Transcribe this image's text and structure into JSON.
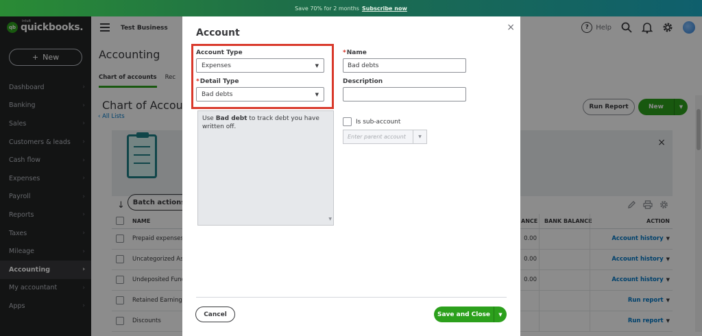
{
  "promo": {
    "text": "Save 70% for 2 months",
    "link": "Subscribe now"
  },
  "sidebar": {
    "brand_small": "intuit",
    "brand": "quickbooks.",
    "logo_mark": "qb",
    "new_plus": "+",
    "new_label": "New",
    "chevron": "›",
    "items": [
      {
        "label": "Dashboard"
      },
      {
        "label": "Banking"
      },
      {
        "label": "Sales"
      },
      {
        "label": "Customers & leads"
      },
      {
        "label": "Cash flow"
      },
      {
        "label": "Expenses"
      },
      {
        "label": "Payroll"
      },
      {
        "label": "Reports"
      },
      {
        "label": "Taxes"
      },
      {
        "label": "Mileage"
      },
      {
        "label": "Accounting"
      },
      {
        "label": "My accountant"
      },
      {
        "label": "Apps"
      }
    ],
    "active_index": 10
  },
  "header": {
    "business": "Test Business",
    "help_label": "Help",
    "help_glyph": "?"
  },
  "page": {
    "title": "Accounting",
    "tabs": [
      {
        "label": "Chart of accounts"
      },
      {
        "label": "Rec"
      }
    ],
    "subtitle": "Chart of Accoun",
    "all_lists": "‹ All Lists",
    "run_report": "Run Report",
    "new_label": "New",
    "batch_actions": "Batch actions",
    "close_glyph": "×"
  },
  "table": {
    "headers": {
      "name": "NAME",
      "balance": "ANCE",
      "bank_balance": "BANK BALANCE",
      "action": "ACTION"
    },
    "rows": [
      {
        "name": "Prepaid expenses",
        "balance": "0.00",
        "action": "Account history"
      },
      {
        "name": "Uncategorized Ass",
        "balance": "0.00",
        "action": "Account history"
      },
      {
        "name": "Undeposited Func",
        "balance": "0.00",
        "action": "Account history"
      },
      {
        "name": "Retained Earnings",
        "balance": "",
        "action": "Run report"
      },
      {
        "name": "Discounts",
        "balance": "",
        "action": "Run report"
      }
    ]
  },
  "modal": {
    "title": "Account",
    "close_glyph": "×",
    "account_type_label": "Account Type",
    "account_type_value": "Expenses",
    "detail_type_label": "Detail Type",
    "detail_type_value": "Bad debts",
    "required_mark": "*",
    "desc_use": "Use ",
    "desc_term": "Bad debt",
    "desc_rest": " to track debt you have written off.",
    "name_label": "Name",
    "name_value": "Bad debts",
    "description_label": "Description",
    "description_value": "",
    "sub_account_label": "Is sub-account",
    "parent_placeholder": "Enter parent account",
    "cancel_label": "Cancel",
    "save_label": "Save and Close",
    "caret": "▼"
  },
  "colors": {
    "brand_green": "#2ca01c",
    "highlight_red": "#d9382a",
    "link_blue": "#0077c5",
    "sidebar_bg": "#242526"
  }
}
